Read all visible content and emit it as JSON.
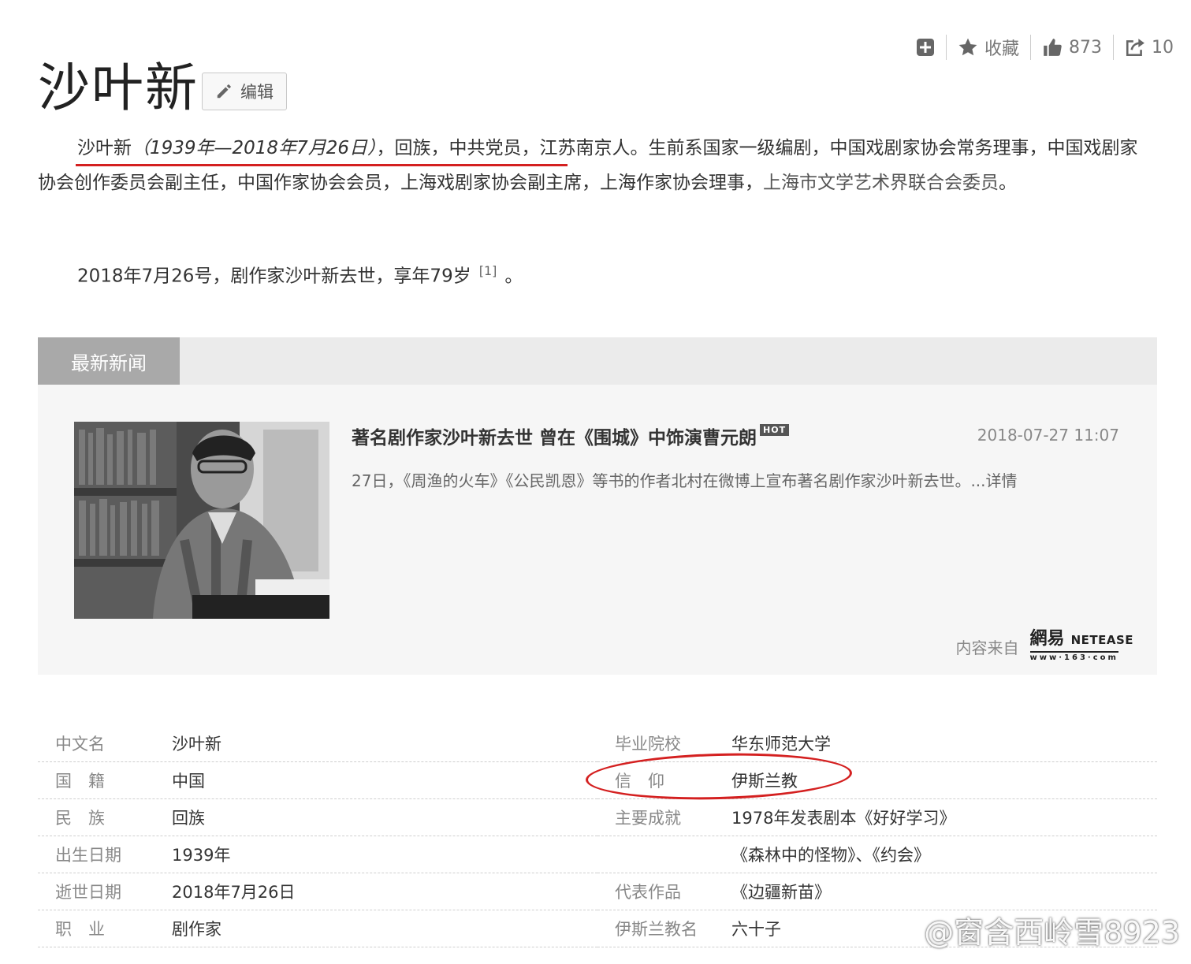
{
  "toolbar": {
    "favorite_label": "收藏",
    "like_count": "873",
    "share_count": "10"
  },
  "title": "沙叶新",
  "edit_label": "编辑",
  "summary": {
    "p1_name": "沙叶新",
    "p1_dates": "（1939年—2018年7月26日）",
    "p1_text": "，回族，中共党员，江苏南京人。生前系国家一级编剧，中国戏剧家协会常务理事，中国戏剧家协会创作委员会副主任，中国作家协会会员，上海戏剧家协会副主席，上海作家协会理事，",
    "p1_link": "上海市文学艺术界联合会委员",
    "p1_end": "。",
    "p2_text": "2018年7月26号，剧作家沙叶新去世，享年79岁",
    "p2_ref": "[1]",
    "p2_end": "。"
  },
  "news": {
    "tab_label": "最新新闻",
    "title": "著名剧作家沙叶新去世 曾在《围城》中饰演曹元朗",
    "hot": "HOT",
    "date": "2018-07-27 11:07",
    "desc": "27日，《周渔的火车》《公民凯恩》等书的作者北村在微博上宣布著名剧作家沙叶新去世。...详情",
    "source_label": "内容来自",
    "source_logo_cn": "網易",
    "source_logo_en": "NETEASE",
    "source_logo_url": "www·163·com"
  },
  "info_left": [
    {
      "k": "中文名",
      "v": "沙叶新"
    },
    {
      "k": "国　籍",
      "v": "中国"
    },
    {
      "k": "民　族",
      "v": "回族"
    },
    {
      "k": "出生日期",
      "v": "1939年"
    },
    {
      "k": "逝世日期",
      "v": "2018年7月26日"
    },
    {
      "k": "职　业",
      "v": "剧作家"
    }
  ],
  "info_right": [
    {
      "k": "毕业院校",
      "v": "华东师范大学"
    },
    {
      "k": "信　仰",
      "v": "伊斯兰教"
    },
    {
      "k": "主要成就",
      "v": "1978年发表剧本《好好学习》"
    },
    {
      "k": "",
      "v": "《森林中的怪物》、《约会》"
    },
    {
      "k": "代表作品",
      "v": "《边疆新苗》"
    },
    {
      "k": "伊斯兰教名",
      "v": "六十子"
    }
  ],
  "watermark": "@窗含西岭雪8923",
  "colors": {
    "annotation_red": "#d42020",
    "tab_gray": "#a9a9a9"
  }
}
